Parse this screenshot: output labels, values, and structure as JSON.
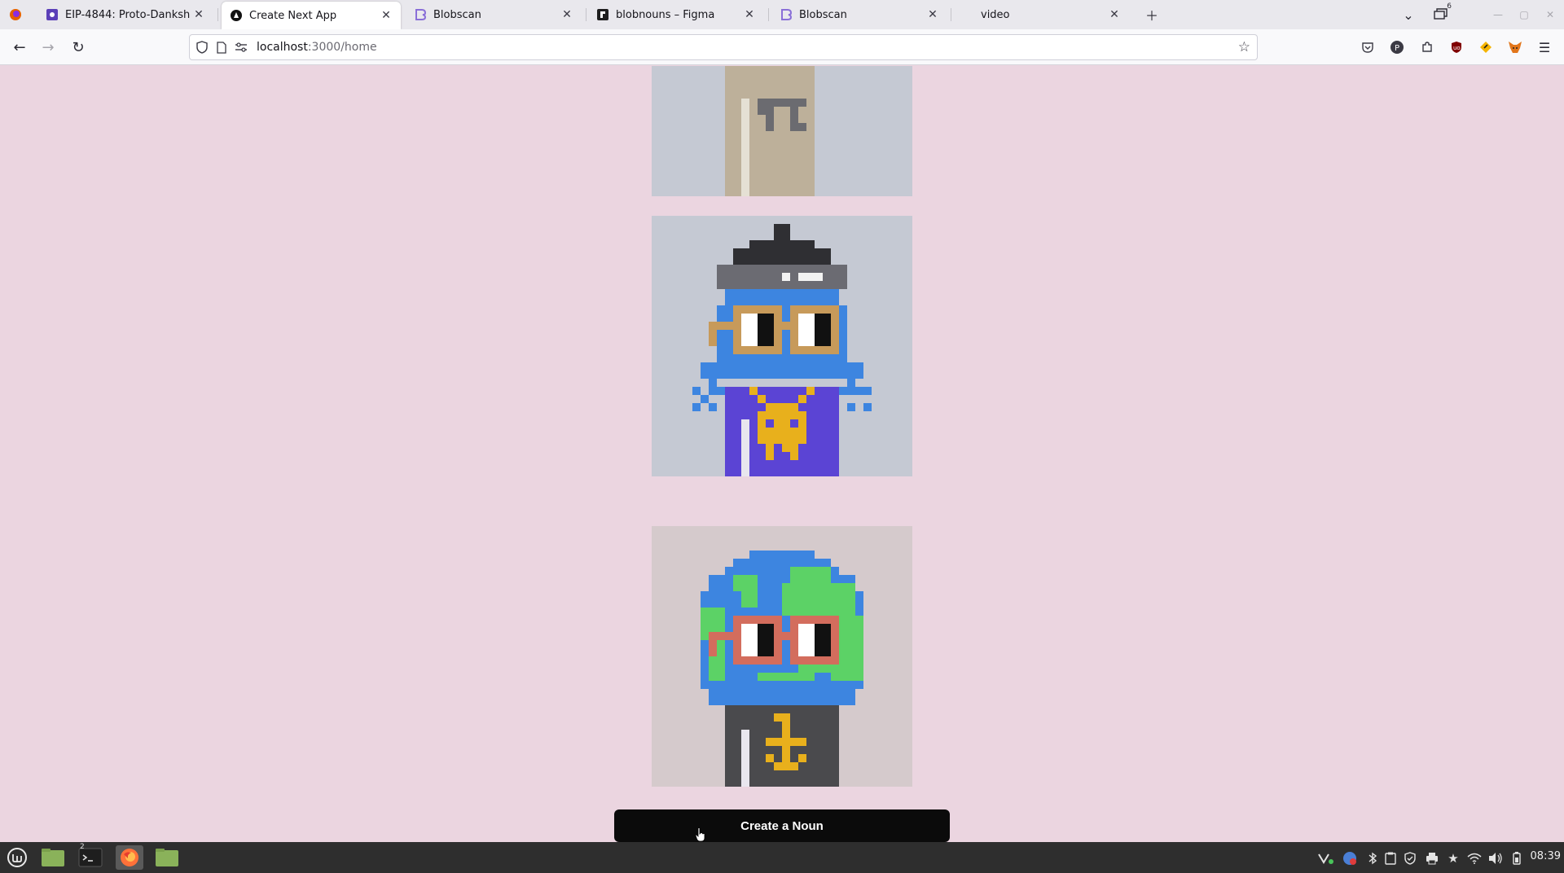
{
  "browser": {
    "tabs": [
      {
        "title": "EIP-4844: Proto-Danksharding",
        "icon": "ethereum-magicians-icon",
        "active": false
      },
      {
        "title": "Create Next App",
        "icon": "nextjs-icon",
        "active": true
      },
      {
        "title": "Blobscan",
        "icon": "blobscan-icon",
        "active": false
      },
      {
        "title": "blobnouns – Figma",
        "icon": "figma-icon",
        "active": false
      },
      {
        "title": "Blobscan",
        "icon": "blobscan-icon",
        "active": false
      },
      {
        "title": "video",
        "icon": "",
        "active": false
      }
    ],
    "tab_overflow_count": "6",
    "url_host": "localhost",
    "url_path": ":3000/home"
  },
  "page": {
    "nouns": [
      {
        "name": "noun-partial",
        "background": "#c5c9d3"
      },
      {
        "name": "noun-blue-beanie",
        "background": "#c5c9d3"
      },
      {
        "name": "noun-earth",
        "background": "#d5cacc"
      }
    ],
    "create_button_label": "Create a Noun"
  },
  "taskbar": {
    "clock": "08:39",
    "terminal_badge": "2"
  },
  "colors": {
    "page_background": "#ebd5e0",
    "button_background": "#0b0b0b",
    "taskbar_background": "#2e2e2e"
  }
}
